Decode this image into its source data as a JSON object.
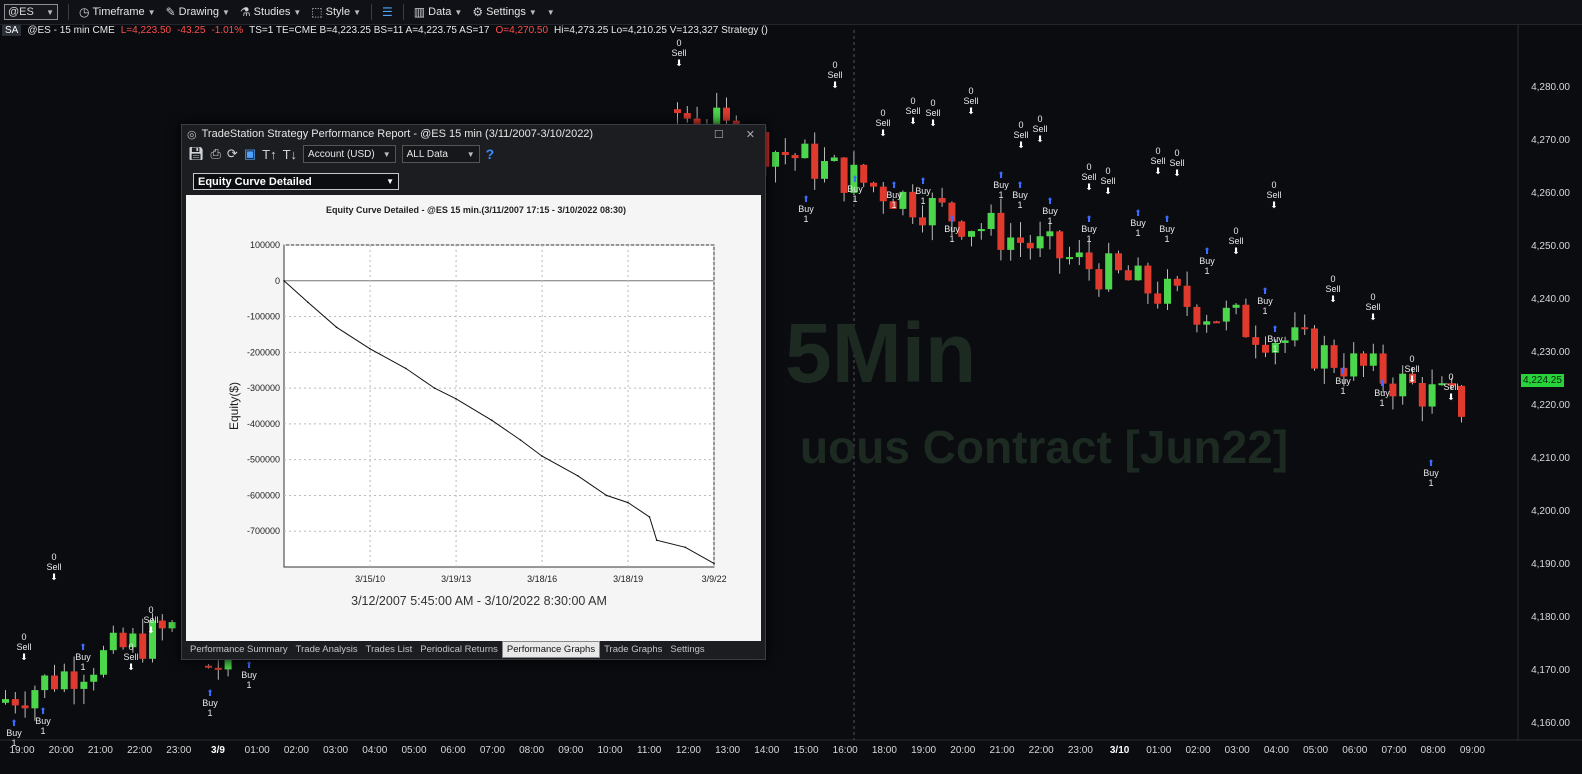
{
  "toolbar": {
    "symbol": "@ES",
    "timeframe": "Timeframe",
    "drawing": "Drawing",
    "studies": "Studies",
    "style": "Style",
    "data": "Data",
    "settings": "Settings"
  },
  "info_line": {
    "badge": "SA",
    "symbol_desc": "@ES - 15 min CME",
    "last": "L=4,223.50",
    "change": "-43.25",
    "pct": "-1.01%",
    "rest": "TS=1  TE=CME  B=4,223.25  BS=11  A=4,223.75  AS=17",
    "open": "O=4,270.50",
    "rest2": "Hi=4,273.25  Lo=4,210.25  V=123,327  Strategy ()"
  },
  "price_axis": [
    "4,280.00",
    "4,270.00",
    "4,260.00",
    "4,250.00",
    "4,240.00",
    "4,230.00",
    "4,220.00",
    "4,210.00",
    "4,200.00",
    "4,190.00",
    "4,180.00",
    "4,170.00",
    "4,160.00"
  ],
  "last_price": "4,224.25",
  "time_axis": [
    "19:00",
    "20:00",
    "21:00",
    "22:00",
    "23:00",
    "3/9",
    "01:00",
    "02:00",
    "03:00",
    "04:00",
    "05:00",
    "06:00",
    "07:00",
    "08:00",
    "09:00",
    "10:00",
    "11:00",
    "12:00",
    "13:00",
    "14:00",
    "15:00",
    "16:00",
    "18:00",
    "19:00",
    "20:00",
    "21:00",
    "22:00",
    "23:00",
    "3/10",
    "01:00",
    "02:00",
    "03:00",
    "04:00",
    "05:00",
    "06:00",
    "07:00",
    "08:00",
    "09:00"
  ],
  "watermark": {
    "line1": "5Min",
    "line2": "uous Contract [Jun22]"
  },
  "signals": {
    "sell_count": "0",
    "sell_label": "Sell",
    "buy_label": "Buy",
    "buy_count": "1"
  },
  "report": {
    "title": "TradeStation Strategy Performance Report - @ES 15 min (3/11/2007-3/10/2022)",
    "account_select": "Account (USD)",
    "data_select": "ALL Data",
    "help": "?",
    "graph_select": "Equity Curve Detailed",
    "tabs": [
      "Performance Summary",
      "Trade Analysis",
      "Trades List",
      "Periodical Returns",
      "Performance Graphs",
      "Trade Graphs",
      "Settings"
    ],
    "active_tab": "Performance Graphs"
  },
  "chart_data": {
    "type": "line",
    "title": "Equity Curve Detailed - @ES 15 min.(3/11/2007 17:15 - 3/10/2022 08:30)",
    "ylabel": "Equity($)",
    "xlabel": "3/12/2007 5:45:00 AM - 3/10/2022 8:30:00 AM",
    "ylim": [
      -800000,
      100000
    ],
    "y_ticks": [
      100000,
      0,
      -100000,
      -200000,
      -300000,
      -400000,
      -500000,
      -600000,
      -700000
    ],
    "x_tick_labels": [
      "3/15/10",
      "3/19/13",
      "3/18/16",
      "3/18/19",
      "3/9/22"
    ],
    "x": [
      "2007-03",
      "2008-01",
      "2009-01",
      "2010-03",
      "2011-06",
      "2012-06",
      "2013-03",
      "2014-06",
      "2015-06",
      "2016-03",
      "2017-06",
      "2018-06",
      "2019-03",
      "2019-12",
      "2020-03",
      "2021-03",
      "2022-03"
    ],
    "series": [
      {
        "values": [
          0,
          -60000,
          -130000,
          -190000,
          -245000,
          -300000,
          -330000,
          -390000,
          -445000,
          -490000,
          -545000,
          -600000,
          -620000,
          -660000,
          -725000,
          -745000,
          -790000
        ]
      }
    ],
    "grid": true
  }
}
